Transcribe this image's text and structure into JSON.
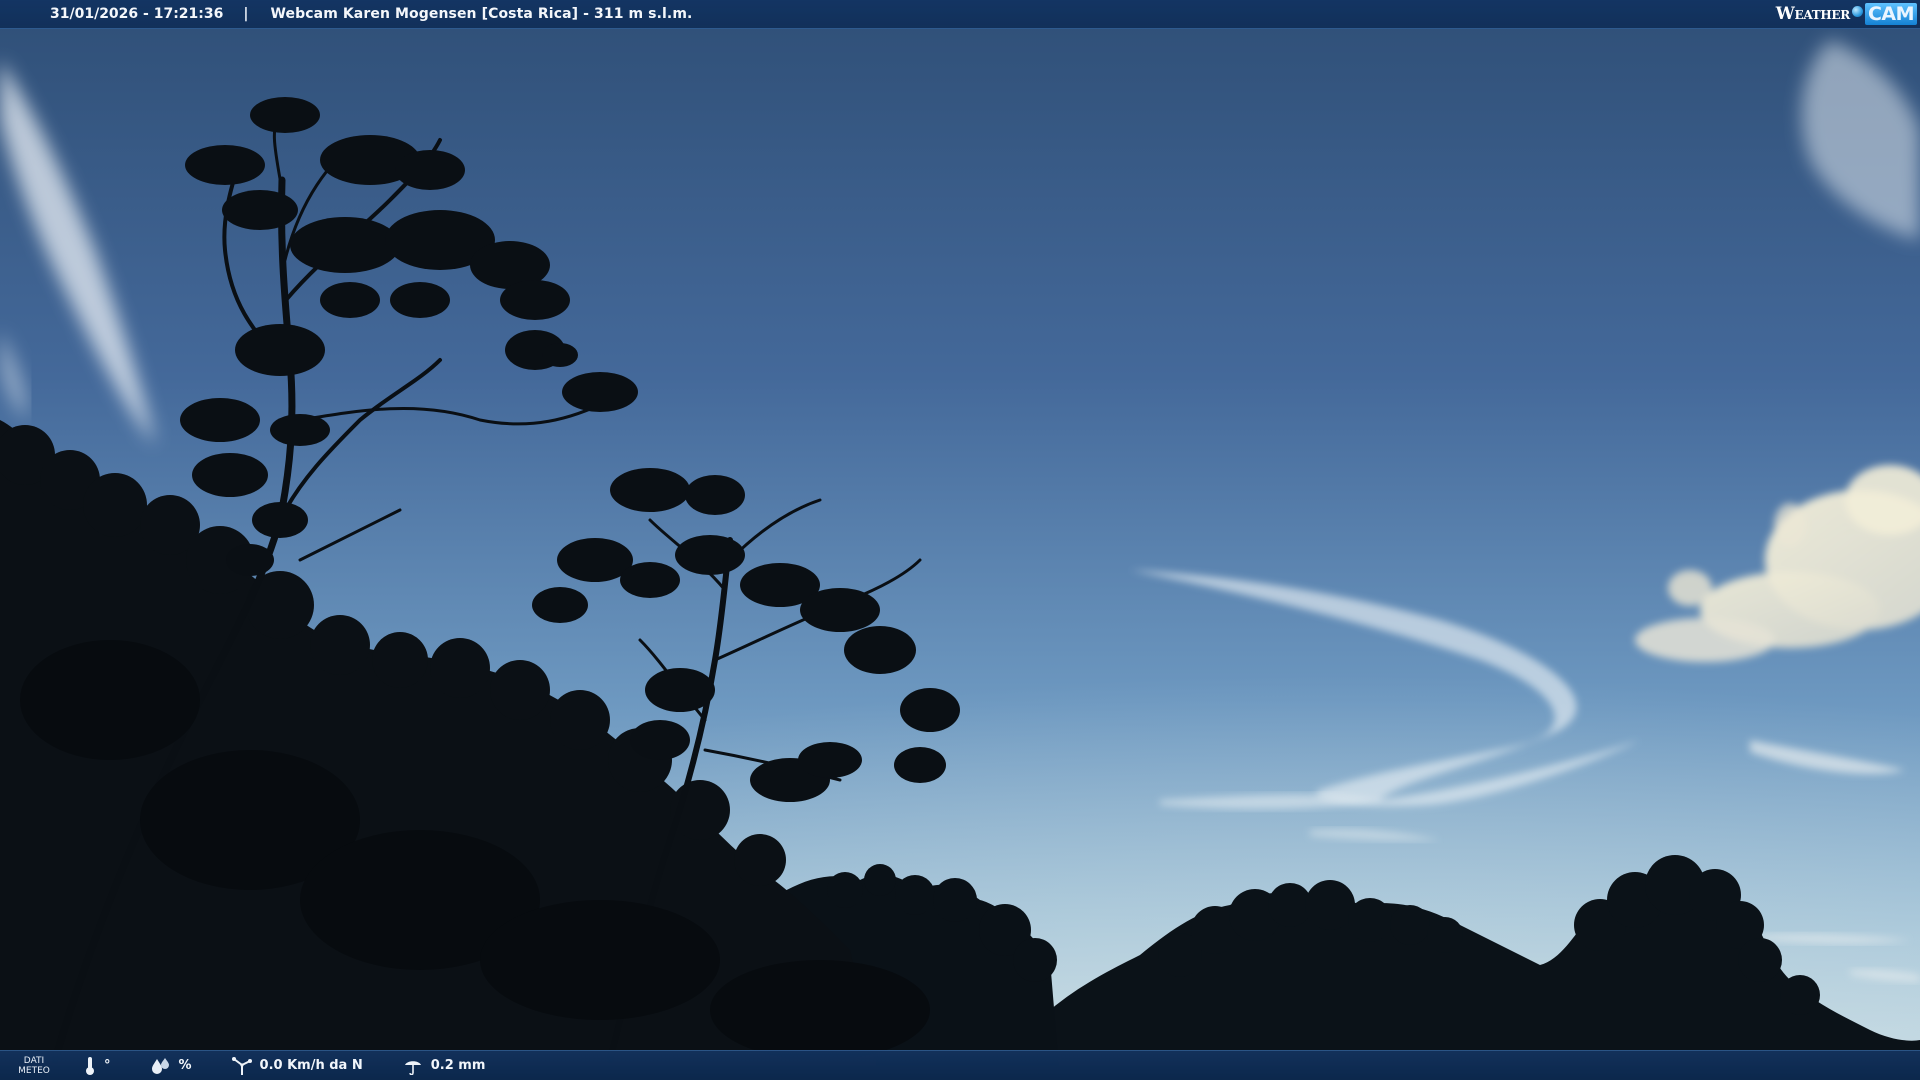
{
  "header": {
    "datetime": "31/01/2026 - 17:21:36",
    "separator": "|",
    "caption": "Webcam Karen Mogensen [Costa Rica]  - 311 m s.l.m."
  },
  "brand": {
    "word": "Weather",
    "cam": "CAM"
  },
  "footer": {
    "meteo_label_line1": "DATI",
    "meteo_label_line2": "METEO",
    "temperature": "°",
    "humidity": "%",
    "wind": "0.0 Km/h da N",
    "rain": "0.2 mm"
  },
  "colors": {
    "sky_top": "#34557c",
    "sky_mid": "#5d88b2",
    "sky_bottom": "#b8d2e0",
    "bar": "#123462",
    "silhouette": "#0a1016"
  },
  "icons": {
    "temperature": "thermometer-icon",
    "humidity": "humidity-drops-icon",
    "wind": "anemometer-icon",
    "rain": "rain-gauge-icon",
    "logo_dot": "globe-dot-icon"
  }
}
